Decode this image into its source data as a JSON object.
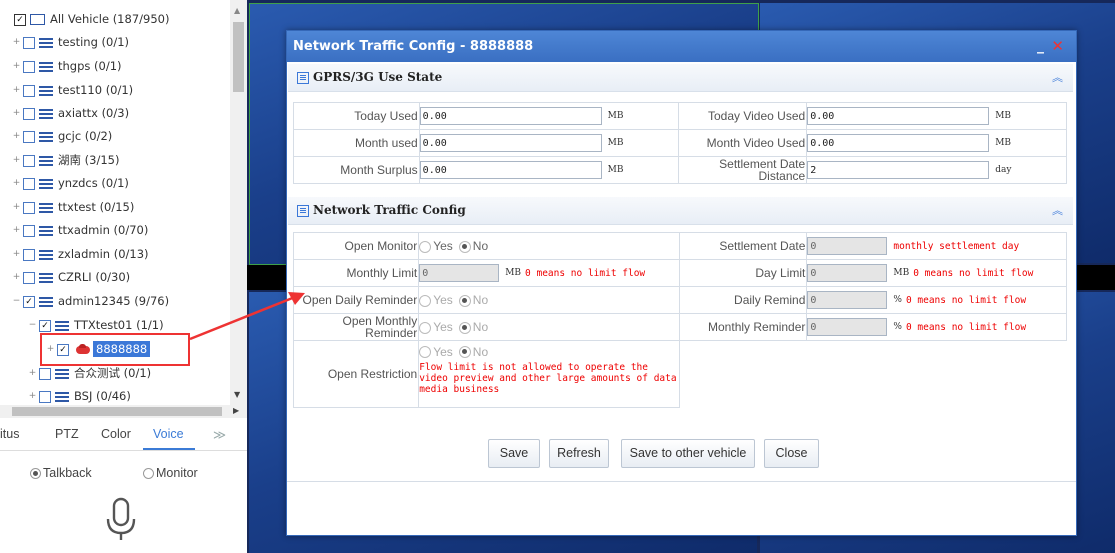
{
  "tree": {
    "root": {
      "label": "All Vehicle (187/950)"
    },
    "items": [
      {
        "label": "testing (0/1)"
      },
      {
        "label": "thgps (0/1)"
      },
      {
        "label": "test110 (0/1)"
      },
      {
        "label": "axiattx (0/3)"
      },
      {
        "label": "gcjc (0/2)"
      },
      {
        "label": "湖南 (3/15)"
      },
      {
        "label": "ynzdcs (0/1)"
      },
      {
        "label": "ttxtest (0/15)"
      },
      {
        "label": "ttxadmin (0/70)"
      },
      {
        "label": "zxladmin (0/13)"
      },
      {
        "label": "CZRLI (0/30)"
      },
      {
        "label": "admin12345 (9/76)"
      }
    ],
    "subgroup": {
      "label": "TTXtest01 (1/1)"
    },
    "vehicle": {
      "label": "8888888"
    },
    "after": [
      {
        "label": "合众测试 (0/1)"
      },
      {
        "label": "BSJ (0/46)"
      }
    ]
  },
  "tabs": {
    "status": "itus",
    "ptz": "PTZ",
    "color": "Color",
    "voice": "Voice",
    "more": "≫"
  },
  "voice": {
    "talkback": "Talkback",
    "monitor": "Monitor"
  },
  "dialog": {
    "title": "Network Traffic Config - 8888888",
    "minimize": "_",
    "close": "✕",
    "gprs": {
      "title": "GPRS/3G Use State",
      "today_used_label": "Today Used",
      "today_used": "0.00",
      "today_video_used_label": "Today Video Used",
      "today_video_used": "0.00",
      "month_used_label": "Month used",
      "month_used": "0.00",
      "month_video_used_label": "Month Video Used",
      "month_video_used": "0.00",
      "month_surplus_label": "Month Surplus",
      "month_surplus": "0.00",
      "settlement_distance_label": "Settlement Date Distance",
      "settlement_distance": "2",
      "unit_mb": "MB",
      "unit_day": "day"
    },
    "traffic": {
      "title": "Network Traffic Config",
      "open_monitor_label": "Open Monitor",
      "settlement_date_label": "Settlement Date",
      "settlement_date": "0",
      "settlement_hint": "monthly settlement day",
      "monthly_limit_label": "Monthly Limit",
      "monthly_limit": "0",
      "day_limit_label": "Day Limit",
      "day_limit": "0",
      "no_limit_hint": "0 means no limit flow",
      "open_daily_reminder_label": "Open Daily Reminder",
      "daily_remind_label": "Daily Remind",
      "daily_remind": "0",
      "open_monthly_reminder_label": "Open Monthly Reminder",
      "monthly_reminder_label": "Monthly Reminder",
      "monthly_reminder": "0",
      "open_restriction_label": "Open Restriction",
      "restriction_note": "Flow limit is not allowed to operate the video preview and other large amounts of data media business",
      "yes": "Yes",
      "no": "No",
      "unit_mb": "MB",
      "unit_pct": "%"
    },
    "buttons": {
      "save": "Save",
      "refresh": "Refresh",
      "save_other": "Save to other vehicle",
      "close": "Close"
    }
  }
}
